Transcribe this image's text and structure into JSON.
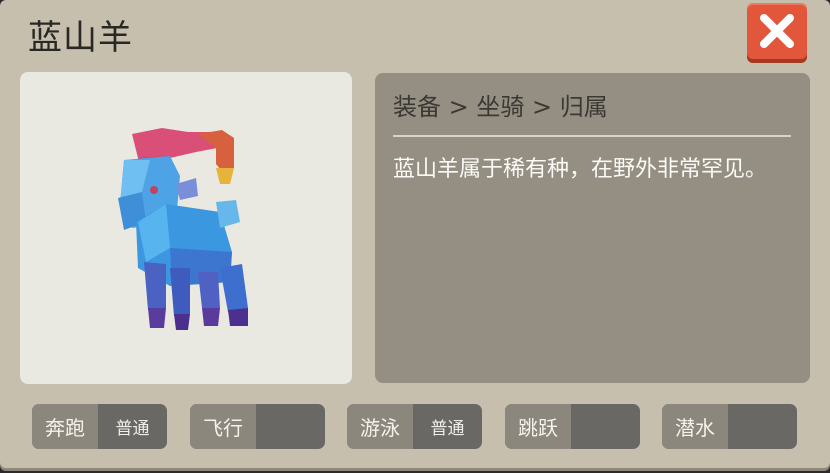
{
  "title": "蓝山羊",
  "close_icon": "close-x-icon",
  "preview_image": "blue-mountain-goat-model",
  "breadcrumb": "装备 > 坐骑 > 归属",
  "description": "蓝山羊属于稀有种，在野外非常罕见。",
  "stats": [
    {
      "label": "奔跑",
      "value": "普通"
    },
    {
      "label": "飞行",
      "value": ""
    },
    {
      "label": "游泳",
      "value": "普通"
    },
    {
      "label": "跳跃",
      "value": ""
    },
    {
      "label": "潜水",
      "value": ""
    }
  ],
  "colors": {
    "accent_close": "#e2573b",
    "panel": "#c6bfad",
    "info_bg": "#958f83"
  }
}
